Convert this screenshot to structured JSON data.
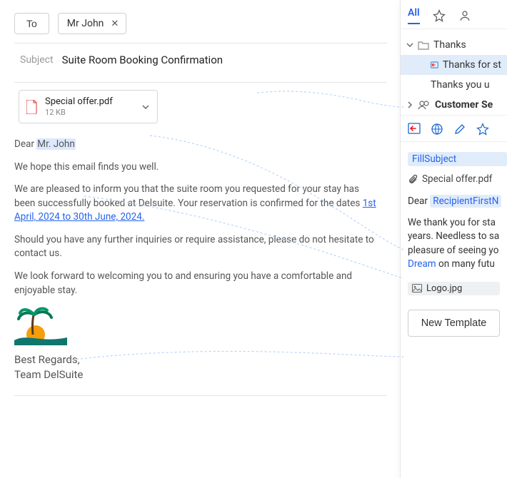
{
  "compose": {
    "to_label": "To",
    "recipient": "Mr John",
    "subject_label": "Subject",
    "subject": "Suite Room Booking Confirmation",
    "attachment": {
      "name": "Special offer.pdf",
      "size": "12 KB"
    },
    "greeting_prefix": "Dear",
    "greeting_name": "Mr. John",
    "p1": "We hope this email finds you well.",
    "p2a": "We are pleased to inform you that the suite room you requested for your stay has been successfully booked at Delsuite. Your reservation is confirmed for the dates ",
    "p2_dates": "1st April, 2024 to 30th June, 2024.",
    "p3": "Should you have any further inquiries or require assistance, please do not hesitate to contact us.",
    "p4": "We look forward to welcoming you to and ensuring you have a  comfortable and enjoyable stay.",
    "sig1": "Best Regards,",
    "sig2": "Team DelSuite"
  },
  "sidebar": {
    "tab_all": "All",
    "folders": {
      "thanks": "Thanks",
      "child_selected": "Thanks for st",
      "child2": "Thanks you u",
      "customer": "Customer Se"
    },
    "fill_subject": "FillSubject",
    "attachment": "Special offer.pdf",
    "greeting_prefix": "Dear",
    "token_recipient": "RecipientFirstN",
    "preview_line": "We thank you for sta",
    "preview_line2": "years. Needless to sa",
    "preview_line3": "pleasure of seeing yo",
    "preview_link": "Dream",
    "preview_line4": " on many futu",
    "logo_chip": "Logo.jpg",
    "new_template": "New Template"
  }
}
